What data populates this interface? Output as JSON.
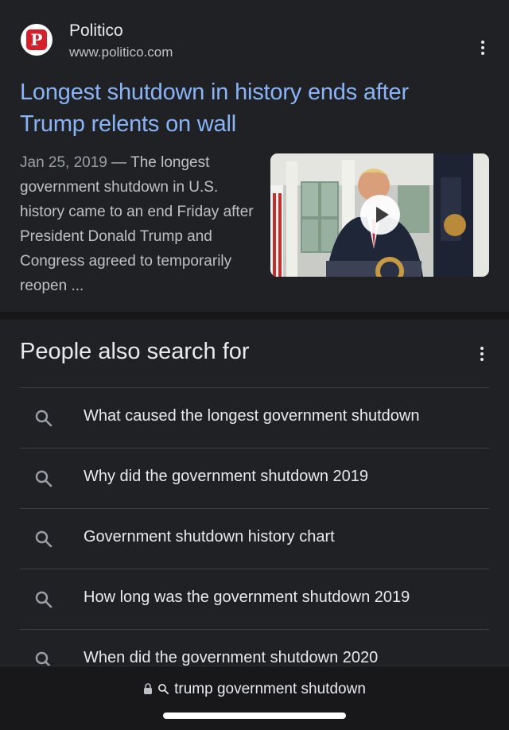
{
  "result": {
    "site_name": "Politico",
    "site_url": "www.politico.com",
    "favicon_letter": "P",
    "favicon_color": "#d3202a",
    "title": "Longest shutdown in history ends after Trump relents on wall",
    "date": "Jan 25, 2019",
    "snippet": " — The longest government shutdown in U.S. history came to an end Friday after President Donald Trump and Congress agreed to temporarily reopen ...",
    "thumbnail_icon": "video-play-icon"
  },
  "people_also_search": {
    "heading": "People also search for",
    "items": [
      {
        "label": "What caused the longest government shutdown",
        "icon": "search-icon"
      },
      {
        "label": "Why did the government shutdown 2019",
        "icon": "search-icon"
      },
      {
        "label": "Government shutdown history chart",
        "icon": "search-icon"
      },
      {
        "label": "How long was the government shutdown 2019",
        "icon": "search-icon"
      },
      {
        "label": "When did the government shutdown 2020",
        "icon": "search-icon"
      }
    ]
  },
  "address_bar": {
    "query": "trump government shutdown",
    "icons": [
      "lock-icon",
      "search-icon"
    ]
  },
  "colors": {
    "background": "#202124",
    "link": "#8ab4f8",
    "text": "#e8eaed",
    "muted": "#bdc1c6"
  }
}
